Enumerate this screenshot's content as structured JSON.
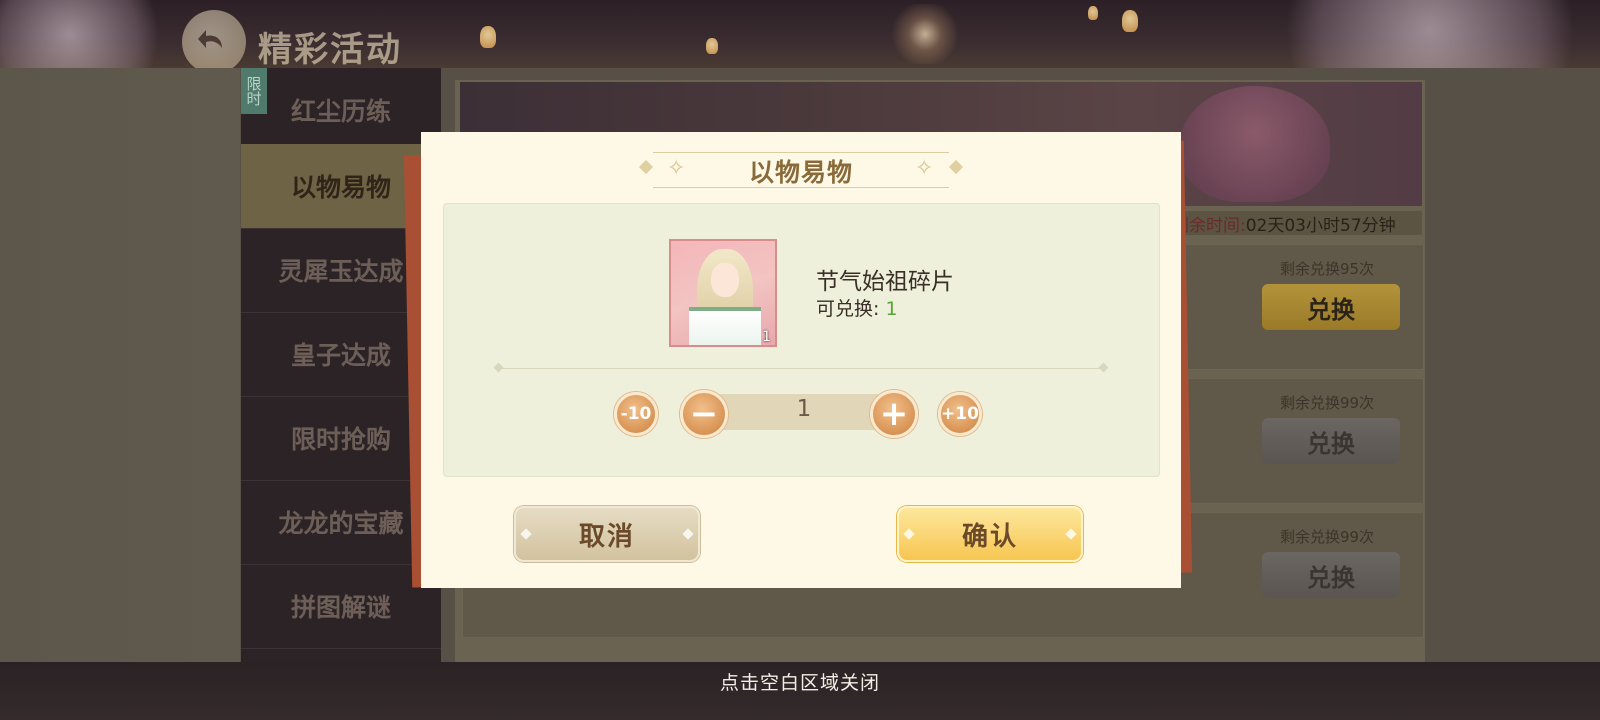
{
  "header": {
    "title": "精彩活动"
  },
  "menu": {
    "limited_tag": "限时",
    "items": [
      {
        "label": "红尘历练"
      },
      {
        "label": "以物易物"
      },
      {
        "label": "灵犀玉达成"
      },
      {
        "label": "皇子达成"
      },
      {
        "label": "限时抢购"
      },
      {
        "label": "龙龙的宝藏"
      },
      {
        "label": "拼图解谜"
      }
    ]
  },
  "banner": {
    "timer_label": "剩余时间:",
    "timer_value": "02天03小时57分钟"
  },
  "reward_rows": [
    {
      "remaining": "剩余兑换95次",
      "button": "兑换"
    },
    {
      "remaining": "剩余兑换99次",
      "button": "兑换"
    },
    {
      "remaining": "剩余兑换99次",
      "button": "兑换"
    }
  ],
  "dialog": {
    "title": "以物易物",
    "item": {
      "name": "节气始祖碎片",
      "exchangeable_label": "可兑换:",
      "exchangeable_value": "1",
      "icon_count": "1"
    },
    "quantity": {
      "minus10": "-10",
      "minus": "−",
      "value": "1",
      "plus": "+",
      "plus10": "+10"
    },
    "cancel_label": "取消",
    "confirm_label": "确认"
  },
  "close_hint": "点击空白区域关闭",
  "colors": {
    "dialog_bg": "#fdf9e6",
    "confirm_gold": "#f7c652",
    "exchangeable_green": "#5aa33a",
    "red_card": "#a94f34"
  }
}
